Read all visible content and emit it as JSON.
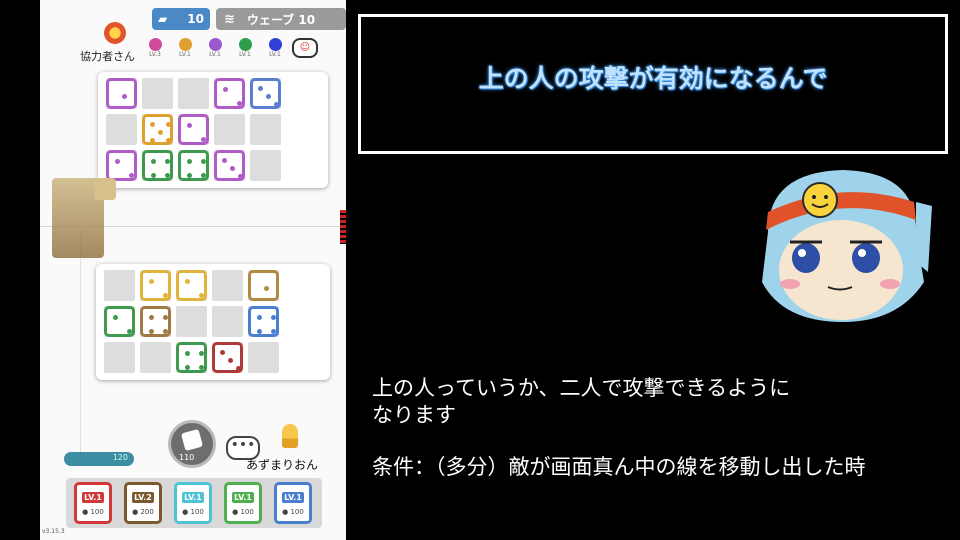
{
  "game": {
    "hud": {
      "sp_value": "10",
      "wave_label": "ウェーブ 10"
    },
    "cooperator_label": "協力者さん",
    "partner_deck": [
      {
        "color": "#d04a9a",
        "level": "LV.3"
      },
      {
        "color": "#e0a030",
        "level": "LV.1"
      },
      {
        "color": "#9b59d0",
        "level": "LV.1"
      },
      {
        "color": "#2e9e4a",
        "level": "LV.1"
      },
      {
        "color": "#2f3fd8",
        "level": "LV.1"
      }
    ],
    "partner_name": "あずまりおん",
    "sp_bar_value": "120",
    "roll_cost": "110",
    "upgrades": [
      {
        "level": "LV.1",
        "cost": "100",
        "color": "#d13838"
      },
      {
        "level": "LV.2",
        "cost": "200",
        "color": "#7a5a2c"
      },
      {
        "level": "LV.1",
        "cost": "100",
        "color": "#4fc3d6"
      },
      {
        "level": "LV.1",
        "cost": "100",
        "color": "#4fb04f"
      },
      {
        "level": "LV.1",
        "cost": "100",
        "color": "#4a7fd0"
      }
    ],
    "version": "v3.15.3"
  },
  "video": {
    "subtitle": "上の人の攻撃が有効になるんで",
    "narration_line1": "上の人っていうか、二人で攻撃できるように",
    "narration_line2": "なります",
    "condition": "条件：（多分）敵が画面真ん中の線を移動し出した時"
  },
  "colors": {
    "subtitle_text": "#bfe3ff",
    "subtitle_glow": "#3b8fe0"
  }
}
